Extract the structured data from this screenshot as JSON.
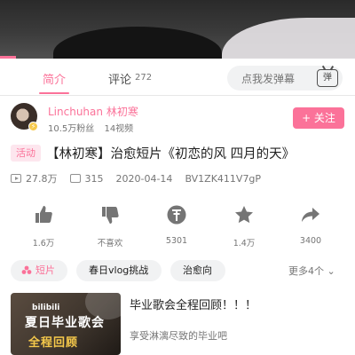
{
  "tabs": {
    "intro_label": "简介",
    "comment_label": "评论",
    "comment_count": "272",
    "danmaku_placeholder": "点我发弹幕",
    "danmaku_icon_text": "弹"
  },
  "uploader": {
    "name": "Linchuhan 林初寒",
    "followers": "10.5万粉丝",
    "videos": "14视频",
    "follow_label": "+ 关注"
  },
  "video": {
    "tag": "活动",
    "title": "【林初寒】治愈短片《初恋的风  四月的天》",
    "views": "27.8万",
    "danmaku_count": "315",
    "date": "2020-04-14",
    "bvid": "BV1ZK411V7gP"
  },
  "actions": {
    "like": "1.6万",
    "dislike": "不喜欢",
    "coin": "5301",
    "favorite": "1.4万",
    "share": "3400"
  },
  "tags": {
    "items": [
      "短片",
      "春日vlog挑战",
      "治愈向"
    ],
    "more": "更多4个"
  },
  "related": {
    "title": "毕业歌会全程回顾！！！",
    "description": "享受淋漓尽致的毕业吧",
    "thumb_line1": "bilibili",
    "thumb_line2": "夏日毕业歌会",
    "thumb_line3": "全程回顾"
  },
  "colors": {
    "accent": "#fb7299",
    "text": "#212121",
    "muted": "#757575"
  }
}
